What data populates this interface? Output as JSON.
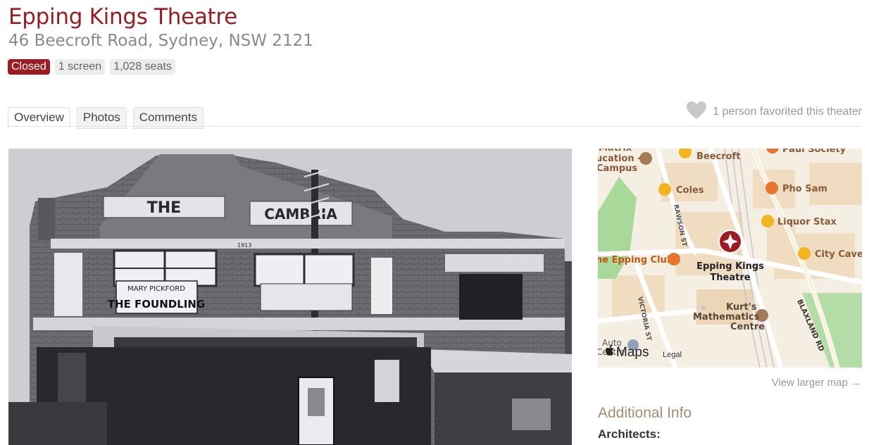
{
  "theater": {
    "name": "Epping Kings Theatre",
    "address": "46 Beecroft Road, Sydney, NSW 2121",
    "status": "Closed",
    "screens": "1 screen",
    "seats": "1,028 seats"
  },
  "tabs": [
    {
      "label": "Overview",
      "active": true
    },
    {
      "label": "Photos",
      "active": false
    },
    {
      "label": "Comments",
      "active": false
    }
  ],
  "favorites": {
    "text": "1 person favorited this theater",
    "icon": "heart-icon"
  },
  "photo": {
    "sign_main": "THE",
    "sign_name": "CAMBRIA",
    "poster_line1": "MARY PICKFORD",
    "poster_line2": "THE FOUNDLING",
    "year": "1913"
  },
  "map": {
    "pois": {
      "matrix": "Matrix\nucation -\nCampus",
      "beecroft": "Beecroft",
      "paul": "Paul Society",
      "coles": "Coles",
      "pho": "Pho Sam",
      "liquor": "Liquor Stax",
      "city_cave": "City Cave",
      "epping_club": "he Epping Club",
      "marker_line1": "Epping Kings",
      "marker_line2": "Theatre",
      "kurts1": "Kurt's",
      "kurts2": "Mathematics",
      "kurts3": "Centre",
      "auto1": "Auto",
      "auto2": "Centre"
    },
    "streets": {
      "rawson": "RAWSON ST",
      "victoria": "VICTORIA ST",
      "blaxland": "BLAXLAND RD"
    },
    "logo": "Maps",
    "legal": "Legal",
    "marker_color": "#9b1c23"
  },
  "view_larger_map": "View larger map →",
  "additional_info": {
    "title": "Additional Info",
    "architects_label": "Architects:"
  },
  "colors": {
    "brand": "#9b1c23",
    "info": "#a68b72"
  }
}
